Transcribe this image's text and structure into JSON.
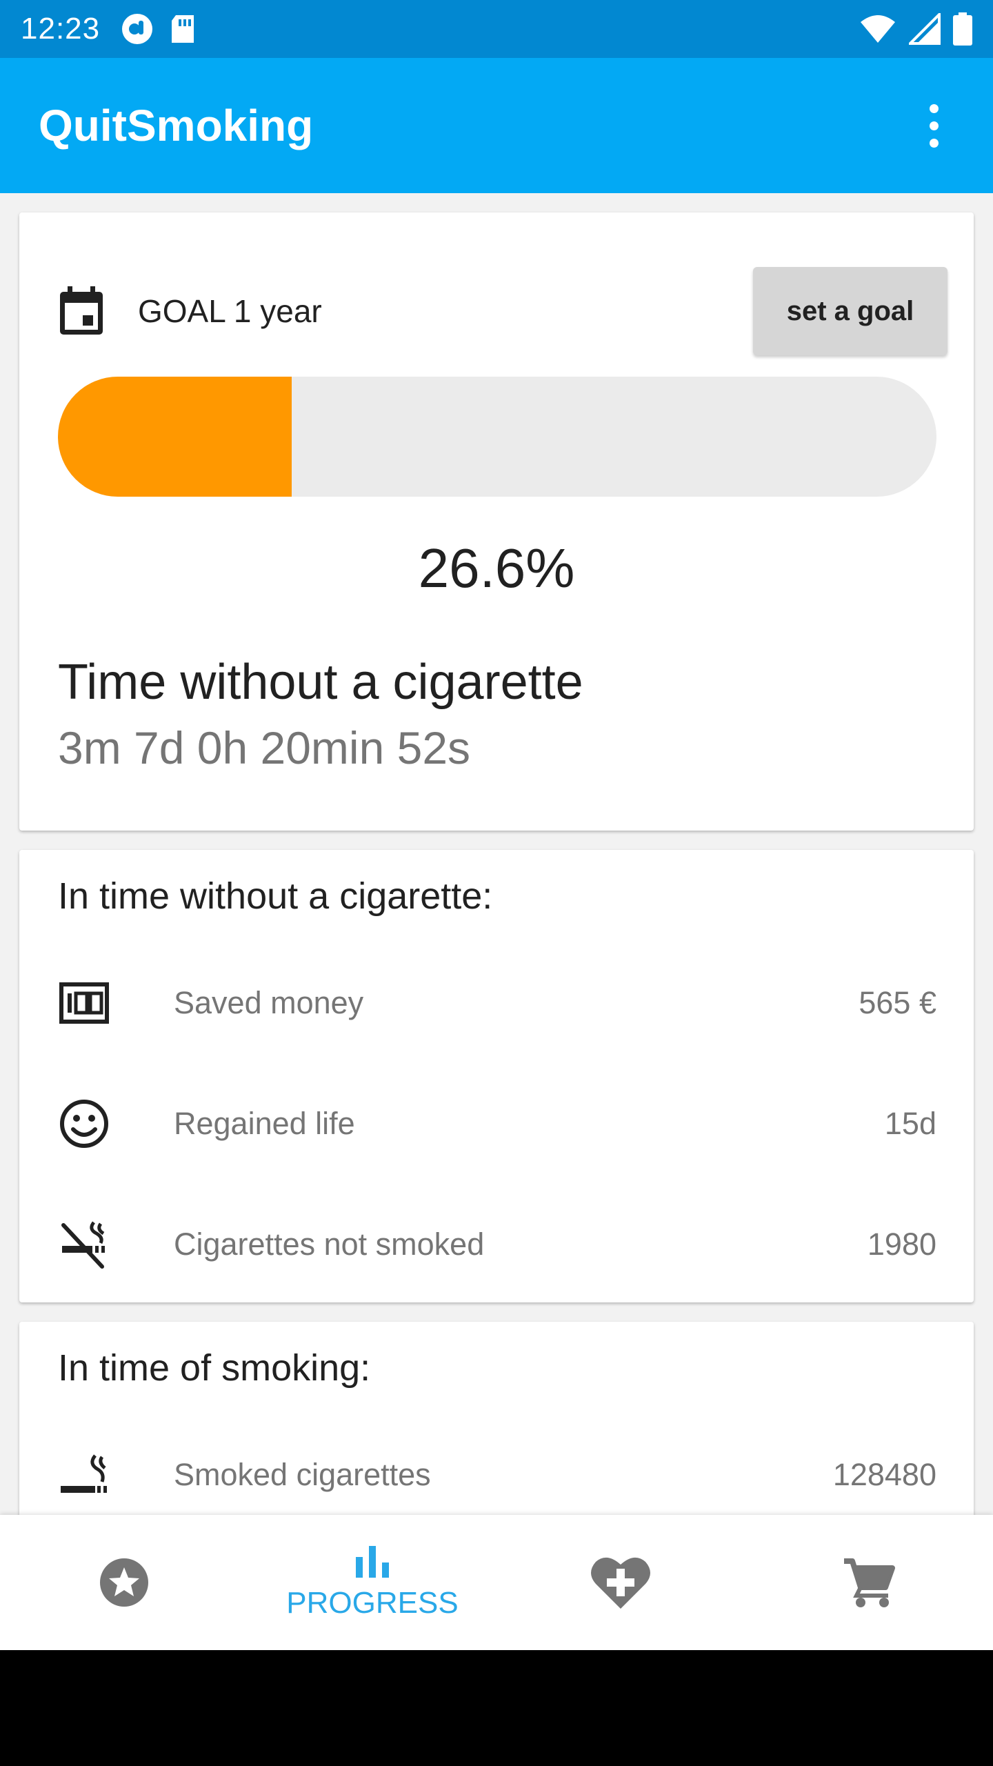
{
  "status_bar": {
    "time": "12:23"
  },
  "app_bar": {
    "title": "QuitSmoking"
  },
  "goal_card": {
    "goal_text": "GOAL 1 year",
    "set_goal_label": "set a goal",
    "progress_fraction": 0.266,
    "percent_text": "26.6%",
    "title": "Time without a cigarette",
    "elapsed": "3m 7d 0h 20min 52s"
  },
  "savings_card": {
    "heading": "In time without a cigarette:",
    "items": [
      {
        "icon": "money-100-icon",
        "label": "Saved money",
        "value": "565 €"
      },
      {
        "icon": "smiley-icon",
        "label": "Regained life",
        "value": "15d"
      },
      {
        "icon": "no-smoking-icon",
        "label": "Cigarettes not smoked",
        "value": "1980"
      }
    ]
  },
  "smoking_card": {
    "heading": "In time of smoking:",
    "items": [
      {
        "icon": "smoking-icon",
        "label": "Smoked cigarettes",
        "value": "128480"
      }
    ]
  },
  "bottom_nav": {
    "items": [
      {
        "icon": "star-icon",
        "label": "",
        "active": false
      },
      {
        "icon": "bar-chart-icon",
        "label": "PROGRESS",
        "active": true
      },
      {
        "icon": "heart-plus-icon",
        "label": "",
        "active": false
      },
      {
        "icon": "cart-icon",
        "label": "",
        "active": false
      }
    ]
  },
  "colors": {
    "status_bar": "#0288d1",
    "app_bar": "#03a9f4",
    "progress_fill": "#ff9800",
    "progress_track": "#ebebeb",
    "nav_active": "#29a8e8",
    "nav_inactive": "#757575"
  }
}
